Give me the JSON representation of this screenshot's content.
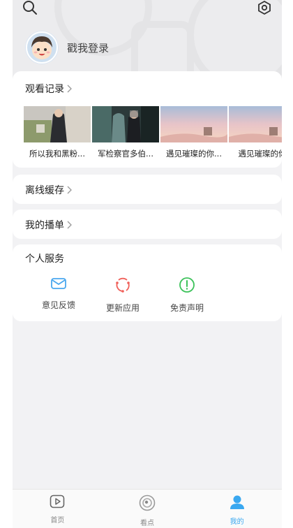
{
  "header": {
    "search_icon": "search-icon",
    "settings_icon": "settings-icon"
  },
  "profile": {
    "login_label": "戳我登录"
  },
  "history": {
    "title": "观看记录",
    "items": [
      {
        "caption": "所以我和黑粉..."
      },
      {
        "caption": "军检察官多伯..."
      },
      {
        "caption": "遇见璀璨的你..."
      },
      {
        "caption": "遇见璀璨的你"
      }
    ]
  },
  "offline": {
    "title": "离线缓存"
  },
  "playlist": {
    "title": "我的播单"
  },
  "services": {
    "title": "个人服务",
    "items": [
      {
        "label": "意见反馈",
        "icon": "mail-icon",
        "color": "#4aa8ef"
      },
      {
        "label": "更新应用",
        "icon": "refresh-icon",
        "color": "#f0605a"
      },
      {
        "label": "免责声明",
        "icon": "exclamation-icon",
        "color": "#3cc25a"
      }
    ]
  },
  "tabbar": {
    "tabs": [
      {
        "label": "首页",
        "icon": "play-icon"
      },
      {
        "label": "看点",
        "icon": "swirl-icon"
      },
      {
        "label": "我的",
        "icon": "user-icon",
        "active": true
      }
    ],
    "accent": "#3aa8f0"
  }
}
